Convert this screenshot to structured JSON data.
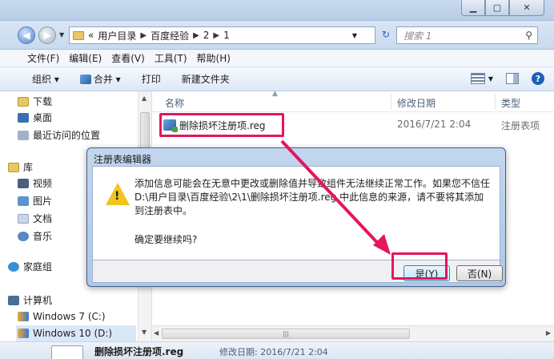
{
  "window": {
    "minimize_icon": "minimize-icon",
    "maximize_icon": "maximize-icon",
    "close_icon": "close-icon"
  },
  "address": {
    "crumbs": [
      "用户目录",
      "百度经验",
      "2",
      "1"
    ],
    "prefix": "«",
    "search_placeholder": "搜索 1"
  },
  "menu": [
    "文件(F)",
    "编辑(E)",
    "查看(V)",
    "工具(T)",
    "帮助(H)"
  ],
  "toolbar": {
    "organize": "组织 ▾",
    "merge": "合并 ▾",
    "print": "打印",
    "new_folder": "新建文件夹"
  },
  "nav": {
    "downloads": "下载",
    "desktop": "桌面",
    "recent": "最近访问的位置",
    "libraries": "库",
    "videos": "视频",
    "pictures": "图片",
    "documents": "文档",
    "music": "音乐",
    "homegroup": "家庭组",
    "computer": "计算机",
    "drive_c": "Windows 7 (C:)",
    "drive_d": "Windows 10 (D:)"
  },
  "columns": {
    "name": "名称",
    "date": "修改日期",
    "type": "类型"
  },
  "file": {
    "name": "删除损坏注册项.reg",
    "date": "2016/7/21 2:04",
    "type": "注册表项"
  },
  "status": {
    "name": "删除损坏注册项.reg",
    "date": "修改日期: 2016/7/21 2:04"
  },
  "dialog": {
    "title": "注册表编辑器",
    "message": "添加信息可能会在无意中更改或删除值并导致组件无法继续正常工作。如果您不信任 D:\\用户目录\\百度经验\\2\\1\\删除损坏注册项.reg 中此信息的来源，请不要将其添加到注册表中。",
    "question": "确定要继续吗?",
    "yes": "是(Y)",
    "no": "否(N)"
  },
  "colors": {
    "highlight": "#e3165e",
    "accent": "#1e5fb8"
  }
}
